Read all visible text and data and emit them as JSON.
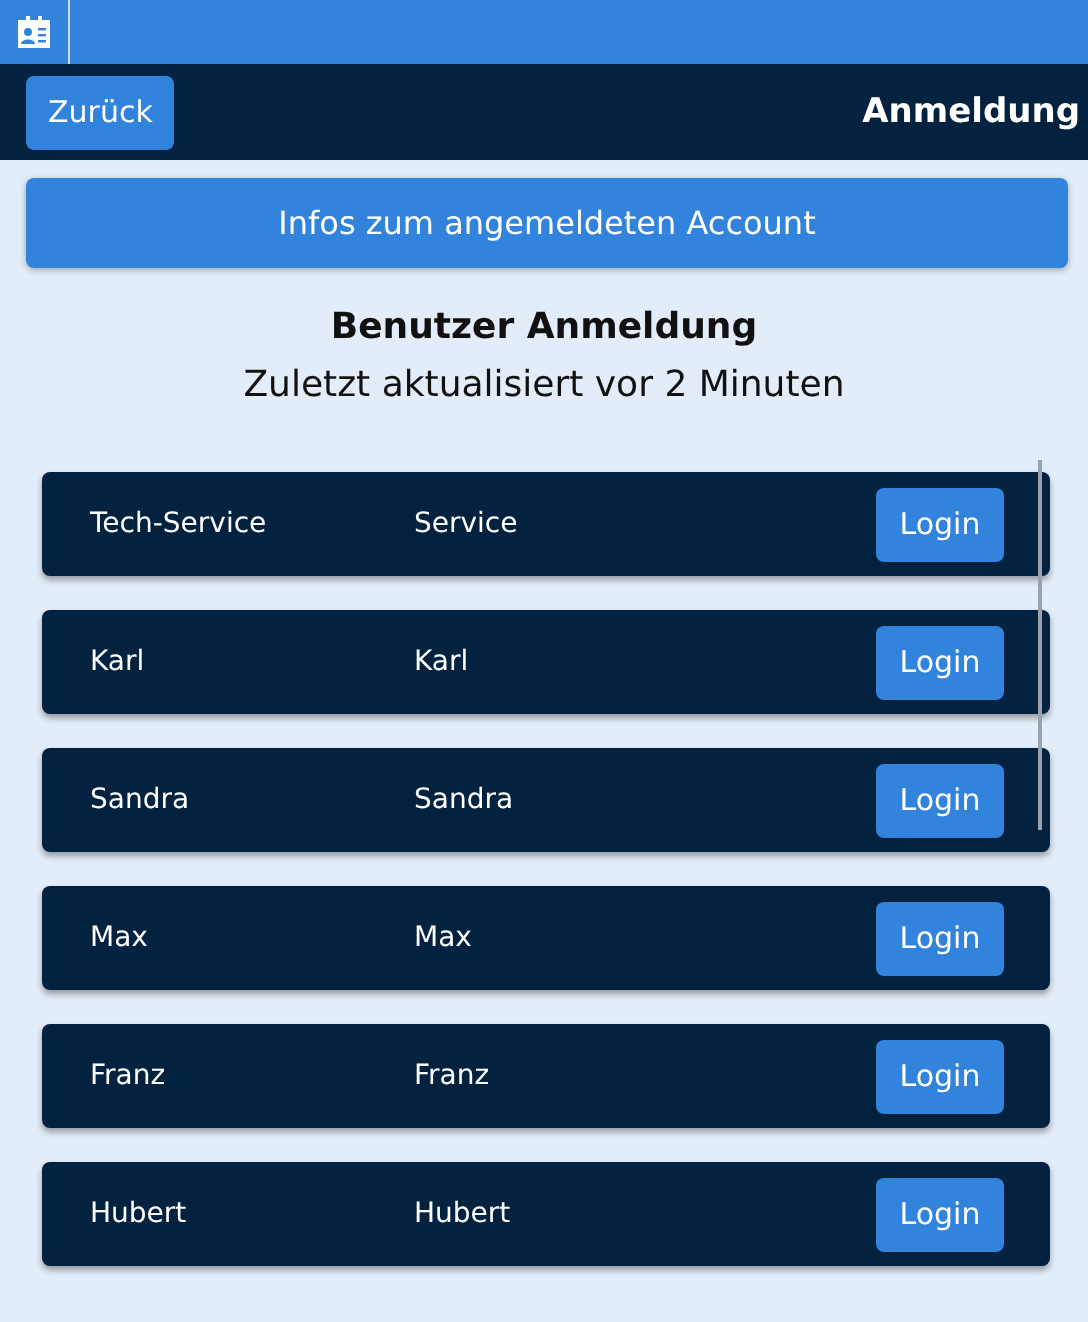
{
  "header": {
    "back_button": "Zurück",
    "title": "Anmeldung"
  },
  "info_button": "Infos zum angemeldeten Account",
  "heading": "Benutzer Anmeldung",
  "subheading": "Zuletzt aktualisiert vor 2 Minuten",
  "users": [
    {
      "name": "Tech-Service",
      "account": "Service",
      "action": "Login"
    },
    {
      "name": "Karl",
      "account": "Karl",
      "action": "Login"
    },
    {
      "name": "Sandra",
      "account": "Sandra",
      "action": "Login"
    },
    {
      "name": "Max",
      "account": "Max",
      "action": "Login"
    },
    {
      "name": "Franz",
      "account": "Franz",
      "action": "Login"
    },
    {
      "name": "Hubert",
      "account": "Hubert",
      "action": "Login"
    }
  ]
}
